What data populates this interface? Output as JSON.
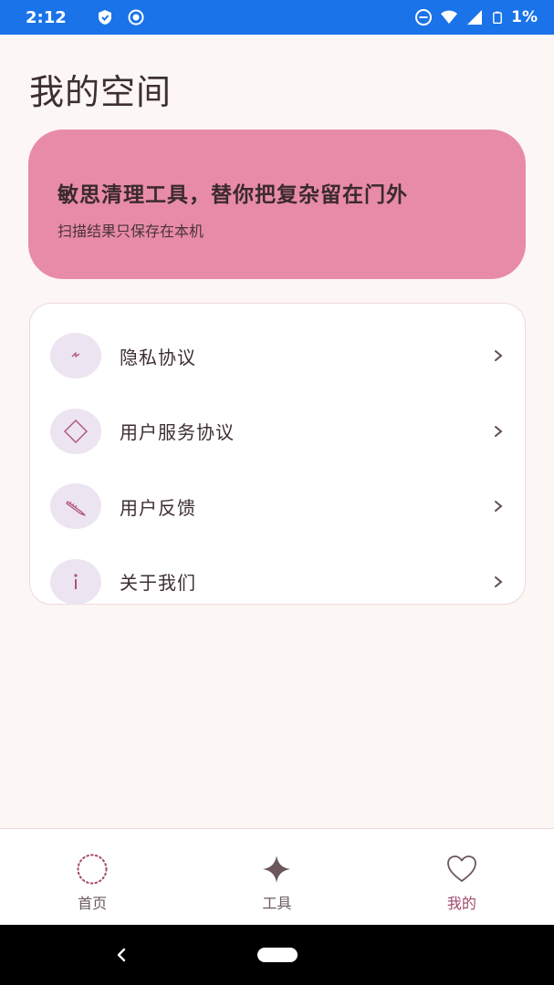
{
  "status_bar": {
    "time": "2:12",
    "battery_text": "1%",
    "icons": [
      "shield-icon",
      "record-icon",
      "do-not-disturb-icon",
      "wifi-icon",
      "signal-icon",
      "battery-icon"
    ]
  },
  "page": {
    "title": "我的空间"
  },
  "banner": {
    "title": "敏思清理工具，替你把复杂留在门外",
    "subtitle": "扫描结果只保存在本机"
  },
  "menu": {
    "items": [
      {
        "label": "隐私协议",
        "icon": "lightning-icon"
      },
      {
        "label": "用户服务协议",
        "icon": "diamond-icon"
      },
      {
        "label": "用户反馈",
        "icon": "pencil-icon"
      },
      {
        "label": "关于我们",
        "icon": "info-icon"
      }
    ]
  },
  "bottom_nav": {
    "items": [
      {
        "label": "首页",
        "icon": "dotted-circle-icon",
        "active": false
      },
      {
        "label": "工具",
        "icon": "sparkle-icon",
        "active": false
      },
      {
        "label": "我的",
        "icon": "heart-icon",
        "active": true
      }
    ]
  },
  "colors": {
    "status_bar": "#1a73e8",
    "background": "#fcf6f5",
    "banner": "#e88ba8",
    "accent": "#a1496b",
    "icon_bg": "#ece4f1"
  }
}
